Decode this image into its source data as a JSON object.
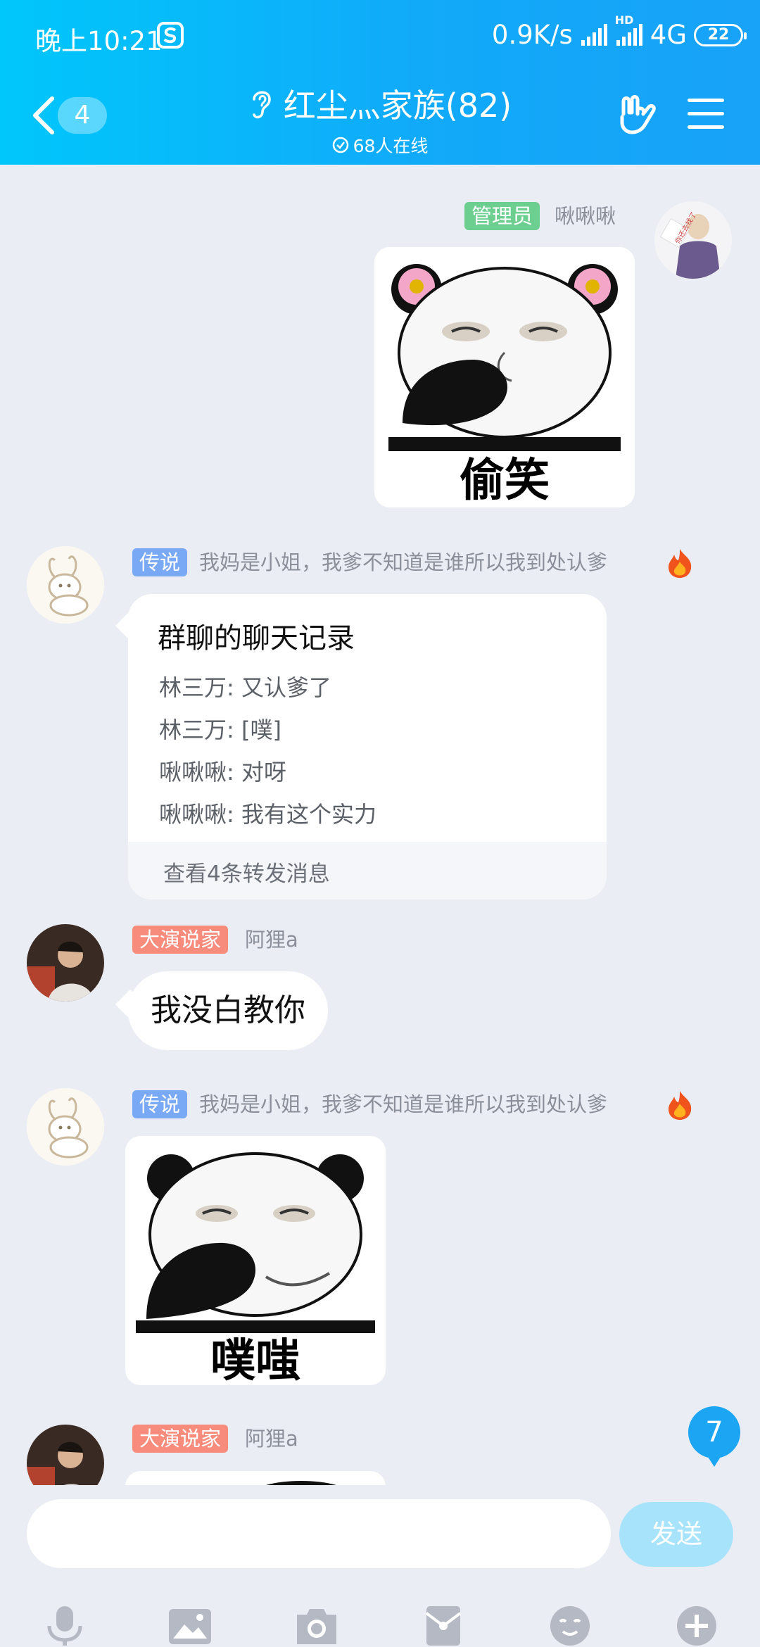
{
  "status_bar": {
    "time": "晚上10:21",
    "network_speed": "0.9K/s",
    "hd": "HD",
    "network_type": "4G",
    "battery": "22"
  },
  "header": {
    "back_count": "4",
    "group_name": "红尘灬家族(82)",
    "online": "68人在线"
  },
  "messages": [
    {
      "type": "image",
      "side": "right",
      "tag": "管理员",
      "nickname": "啾啾啾",
      "caption": "偷笑",
      "avatar_text": "你还去找了"
    },
    {
      "type": "forward",
      "side": "left",
      "tag": "传说",
      "nickname": "我妈是小姐，我爹不知道是谁所以我到处认爹",
      "card_title": "群聊的聊天记录",
      "lines": [
        "林三万:  又认爹了",
        "林三万:  [噗]",
        "啾啾啾:  对呀",
        "啾啾啾:  我有这个实力"
      ],
      "footer": "查看4条转发消息"
    },
    {
      "type": "text",
      "side": "left",
      "tag": "大演说家",
      "nickname": "阿狸a",
      "text": "我没白教你"
    },
    {
      "type": "image",
      "side": "left",
      "tag": "传说",
      "nickname": "我妈是小姐，我爹不知道是谁所以我到处认爹",
      "caption": "噗嗤"
    },
    {
      "type": "image",
      "side": "left",
      "tag": "大演说家",
      "nickname": "阿狸a"
    }
  ],
  "unread_badge": "7",
  "composer": {
    "input_value": "",
    "send_label": "发送"
  },
  "toolbar": [
    "mic-icon",
    "image-icon",
    "camera-icon",
    "redpacket-icon",
    "emoji-icon",
    "plus-icon"
  ],
  "colors": {
    "header_gradient_start": "#00c7fb",
    "header_gradient_end": "#18a2f8",
    "tag_admin": "#6ccf90",
    "tag_legend": "#79a8f4",
    "tag_speaker": "#f78c7c",
    "send_button": "#a7e3fb"
  }
}
